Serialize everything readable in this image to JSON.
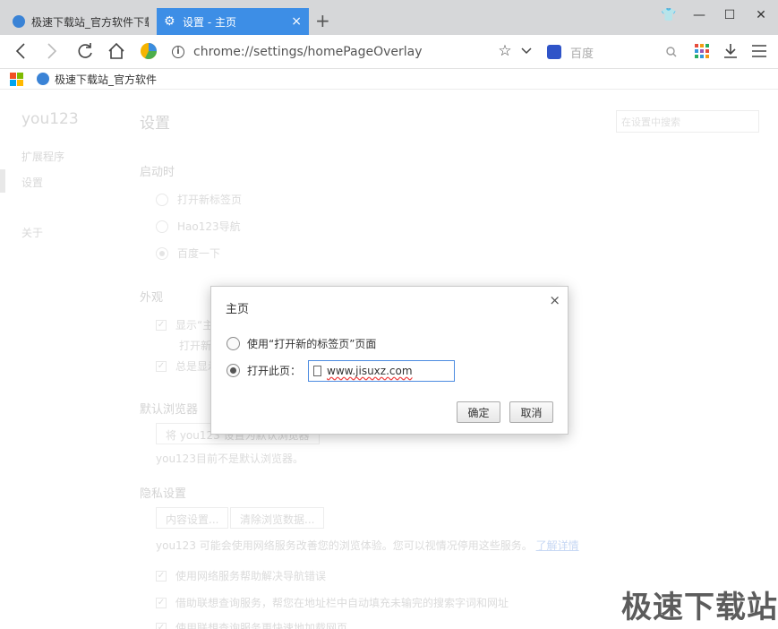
{
  "tabs": [
    {
      "title": "极速下载站_官方软件下载",
      "active": false
    },
    {
      "title": "设置 - 主页",
      "active": true,
      "close": "×"
    }
  ],
  "new_tab": "+",
  "window_controls": {
    "skin": "👕",
    "minimize": "—",
    "maximize": "☐",
    "close": "✕"
  },
  "toolbar": {
    "url": "chrome://settings/homePageOverlay",
    "search_placeholder": "百度",
    "search_engine_icon": "baidu-paw-icon"
  },
  "bookmarks": [
    {
      "label": "极速下载站_官方软件"
    }
  ],
  "apps_colors": [
    "#f25022",
    "#7fba00",
    "#00a4ef",
    "#ffb900"
  ],
  "sidebar": {
    "brand": "you123",
    "items": [
      {
        "label": "扩展程序"
      },
      {
        "label": "设置",
        "selected": true
      },
      {
        "label": "关于"
      }
    ]
  },
  "settings": {
    "title": "设置",
    "search_placeholder": "在设置中搜索",
    "startup": {
      "title": "启动时",
      "options": [
        "打开新标签页",
        "Hao123导航",
        "百度一下"
      ],
      "selected_index": 2
    },
    "appearance": {
      "title": "外观",
      "show_home_label": "显示“主",
      "open_new_label": "打开新",
      "always_show_label": "总是显示"
    },
    "default_browser": {
      "title": "默认浏览器",
      "button": "将 you123 设置为默认浏览器",
      "status": "you123目前不是默认浏览器。"
    },
    "privacy": {
      "title": "隐私设置",
      "content_settings": "内容设置...",
      "clear_data": "清除浏览数据...",
      "description": "you123 可能会使用网络服务改善您的浏览体验。您可以视情况停用这些服务。",
      "learn_more": "了解详情",
      "checks": [
        "使用网络服务帮助解决导航错误",
        "借助联想查询服务，帮您在地址栏中自动填充未输完的搜索字词和网址",
        "使用联想查询服务更快速地加载网页"
      ]
    }
  },
  "dialog": {
    "title": "主页",
    "close": "×",
    "option_newtab": "使用“打开新的标签页”页面",
    "option_open_page": "打开此页：",
    "selected": "open_page",
    "homepage_value": "www.jisuxz.com",
    "ok": "确定",
    "cancel": "取消"
  },
  "watermark": "极速下载站"
}
